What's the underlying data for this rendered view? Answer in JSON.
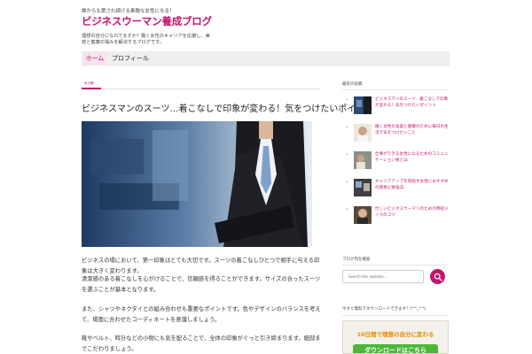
{
  "header": {
    "tagline_top": "誰からも愛され続ける素敵な女性になる！",
    "site_title": "ビジネスウーマン養成ブログ",
    "tagline_bottom": "理想の自分になれてますか？働く女性のキャリアを応援し、美容と健康の悩みを解決するブログです。"
  },
  "nav": {
    "home": "ホーム",
    "item1": "プロフィール"
  },
  "post": {
    "category": "未分類",
    "title": "ビジネスマンのスーツ…着こなしで印象が変わる！気をつけたいポイント",
    "paragraphs": [
      "ビジネスの場において、第一印象はとても大切です。スーツの着こなしひとつで相手に与える印象は大きく変わります。",
      "清潔感のある着こなしを心がけることで、信頼感を得ることができます。サイズの合ったスーツを選ぶことが基本となります。",
      "また、シャツやネクタイとの組み合わせも重要なポイントです。色やデザインのバランスを考えて、場面に合わせたコーディネートを意識しましょう。",
      "靴やベルト、時計などの小物にも気を配ることで、全体の印象がぐっと引き締まります。細部までこだわりましょう。"
    ]
  },
  "sidebar": {
    "recent_heading": "最近の投稿",
    "recent_posts": [
      "ビジネスマンのスーツ…着こなしで印象が変わる！気をつけたいポイント",
      "働く女性の美容と健康のために毎日の生活で気をつけたいこと",
      "仕事ができる女性になるためのコミュニケーション術とは",
      "キャリアアップを目指す女性におすすめの資格と勉強法",
      "忙しいビジネスウーマンのための時短メイクのコツ"
    ],
    "search_heading": "ブログ内を検索",
    "search_placeholder": "Search this website...",
    "download_heading": "今すぐ無料でダウンロードできます！(*^_^*)",
    "banner_top": "10日間で理想の自分に変わる",
    "banner_button": "ダウンロードはこちら"
  },
  "colors": {
    "accent": "#c4166b",
    "banner_green": "#4bb63a",
    "banner_orange": "#e58a00"
  },
  "icons": {
    "search": "search-icon"
  }
}
